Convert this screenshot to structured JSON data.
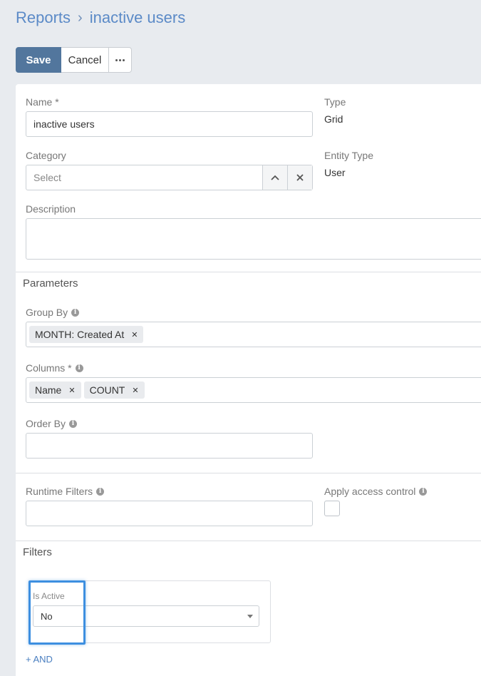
{
  "breadcrumb": {
    "root": "Reports",
    "separator": "›",
    "current": "inactive users"
  },
  "toolbar": {
    "save_label": "Save",
    "cancel_label": "Cancel"
  },
  "form": {
    "name": {
      "label": "Name *",
      "value": "inactive users"
    },
    "type": {
      "label": "Type",
      "value": "Grid"
    },
    "category": {
      "label": "Category",
      "placeholder": "Select"
    },
    "entity_type": {
      "label": "Entity Type",
      "value": "User"
    },
    "description": {
      "label": "Description",
      "value": ""
    }
  },
  "parameters": {
    "title": "Parameters",
    "group_by": {
      "label": "Group By",
      "tags": [
        "MONTH: Created At"
      ]
    },
    "columns": {
      "label": "Columns *",
      "tags": [
        "Name",
        "COUNT"
      ]
    },
    "order_by": {
      "label": "Order By",
      "value": ""
    }
  },
  "runtime": {
    "runtime_filters": {
      "label": "Runtime Filters",
      "value": ""
    },
    "access_control": {
      "label": "Apply access control",
      "checked": false
    }
  },
  "filters": {
    "title": "Filters",
    "items": [
      {
        "label": "Is Active",
        "value": "No"
      }
    ],
    "add_and": "+ AND"
  },
  "colors": {
    "accent": "#52769d",
    "link": "#5b8ac7",
    "highlight": "#3d8fe0"
  },
  "icons": {
    "expand": "chevron-up-icon",
    "clear": "close-icon",
    "info": "info-icon",
    "more": "more-dots-icon"
  }
}
